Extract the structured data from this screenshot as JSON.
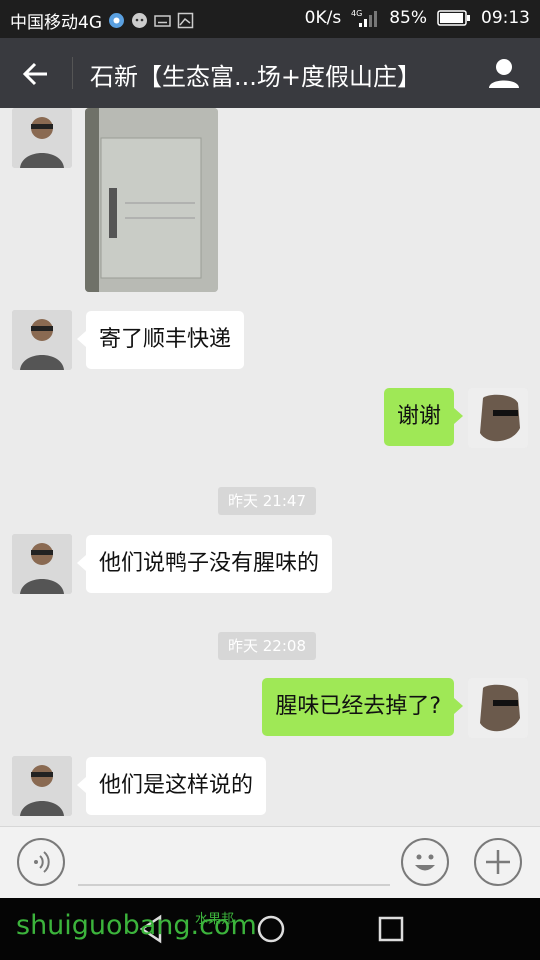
{
  "status_bar": {
    "carrier": "中国移动4G",
    "speed": "0K/s",
    "network": "4G",
    "battery": "85%",
    "time": "09:13"
  },
  "header": {
    "title": "石新【生态富...场+度假山庄】"
  },
  "messages": [
    {
      "type": "image",
      "side": "left",
      "description": "photo-message"
    },
    {
      "type": "text",
      "side": "left",
      "text": "寄了顺丰快递"
    },
    {
      "type": "text",
      "side": "right",
      "text": "谢谢"
    },
    {
      "type": "time",
      "text": "昨天 21:47"
    },
    {
      "type": "text",
      "side": "left",
      "text": "他们说鸭子没有腥味的"
    },
    {
      "type": "time",
      "text": "昨天 22:08"
    },
    {
      "type": "text",
      "side": "right",
      "text": "腥味已经去掉了?"
    },
    {
      "type": "text",
      "side": "left",
      "text": "他们是这样说的"
    }
  ],
  "watermark": {
    "latin": "shuiguobang.com",
    "cn": "水果邦"
  },
  "colors": {
    "outgoing_bubble": "#9fe856",
    "incoming_bubble": "#ffffff",
    "header_bg": "#393a3f",
    "chat_bg": "#ebebeb"
  }
}
